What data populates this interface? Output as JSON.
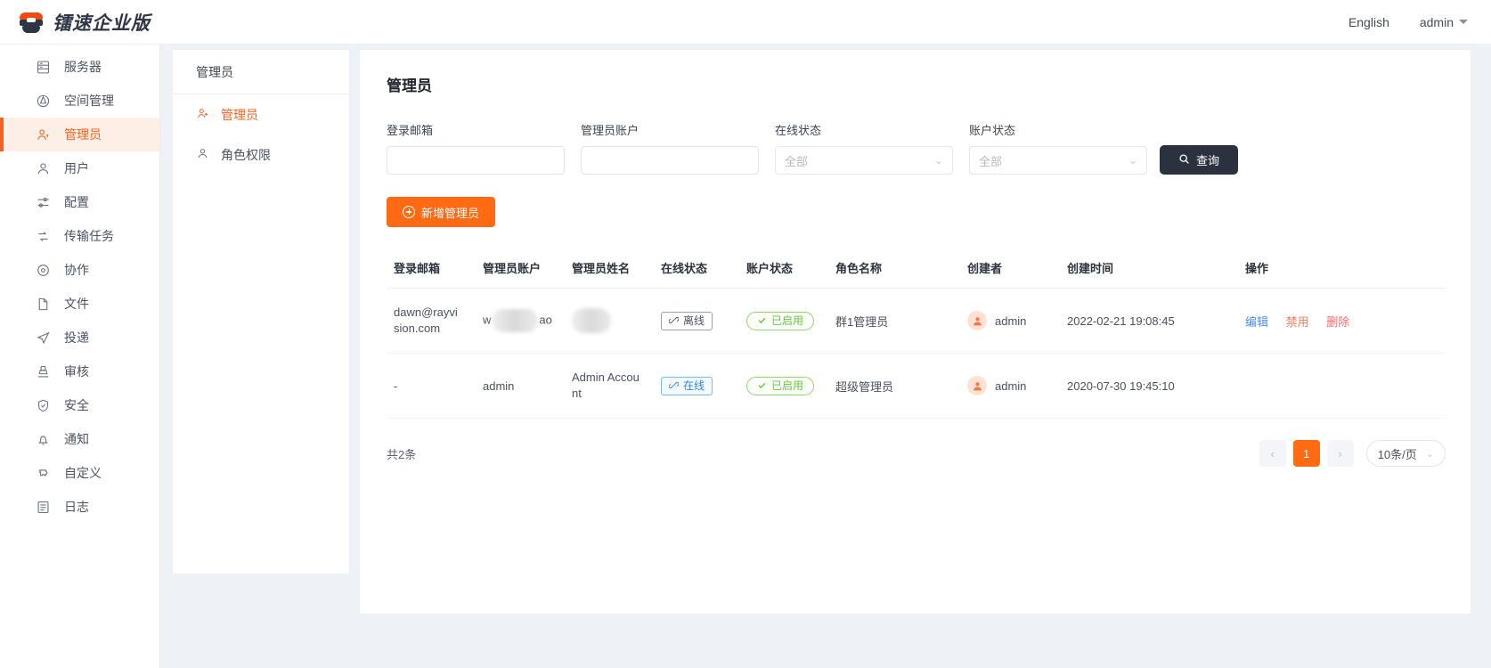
{
  "topbar": {
    "brand_name": "镭速企业版",
    "language": "English",
    "user": "admin"
  },
  "sidebar": {
    "items": [
      {
        "label": "服务器",
        "icon": "server-icon",
        "active": false
      },
      {
        "label": "空间管理",
        "icon": "space-icon",
        "active": false
      },
      {
        "label": "管理员",
        "icon": "admin-icon",
        "active": true
      },
      {
        "label": "用户",
        "icon": "user-icon",
        "active": false
      },
      {
        "label": "配置",
        "icon": "settings-sliders-icon",
        "active": false
      },
      {
        "label": "传输任务",
        "icon": "transfer-icon",
        "active": false
      },
      {
        "label": "协作",
        "icon": "collaboration-icon",
        "active": false
      },
      {
        "label": "文件",
        "icon": "file-icon",
        "active": false
      },
      {
        "label": "投递",
        "icon": "send-icon",
        "active": false
      },
      {
        "label": "审核",
        "icon": "audit-icon",
        "active": false
      },
      {
        "label": "安全",
        "icon": "shield-icon",
        "active": false
      },
      {
        "label": "通知",
        "icon": "bell-icon",
        "active": false
      },
      {
        "label": "自定义",
        "icon": "puzzle-icon",
        "active": false
      },
      {
        "label": "日志",
        "icon": "log-icon",
        "active": false
      }
    ]
  },
  "subpanel": {
    "title": "管理员",
    "items": [
      {
        "label": "管理员",
        "icon": "admin-user-icon",
        "active": true
      },
      {
        "label": "角色权限",
        "icon": "role-user-icon",
        "active": false
      }
    ]
  },
  "main": {
    "page_title": "管理员",
    "filters": {
      "email": {
        "label": "登录邮箱",
        "value": "",
        "placeholder": ""
      },
      "account": {
        "label": "管理员账户",
        "value": "",
        "placeholder": ""
      },
      "online_status": {
        "label": "在线状态",
        "value": "全部"
      },
      "account_status": {
        "label": "账户状态",
        "value": "全部"
      },
      "query_button": "查询"
    },
    "add_button": "新增管理员",
    "table": {
      "headers": [
        "登录邮箱",
        "管理员账户",
        "管理员姓名",
        "在线状态",
        "账户状态",
        "角色名称",
        "创建者",
        "创建时间",
        "操作"
      ],
      "rows": [
        {
          "email": "dawn@rayvision.com",
          "account": "w",
          "account_suffix": "ao",
          "account_redacted": true,
          "name": "",
          "name_redacted": true,
          "online_status": "离线",
          "online_state": "offline",
          "account_status": "已启用",
          "role": "群1管理员",
          "creator": "admin",
          "created_at": "2022-02-21 19:08:45",
          "ops": [
            "编辑",
            "禁用",
            "删除"
          ]
        },
        {
          "email": "-",
          "account": "admin",
          "account_suffix": "",
          "account_redacted": false,
          "name": "Admin Account",
          "name_redacted": false,
          "online_status": "在线",
          "online_state": "online",
          "account_status": "已启用",
          "role": "超级管理员",
          "creator": "admin",
          "created_at": "2020-07-30 19:45:10",
          "ops": []
        }
      ]
    },
    "footer": {
      "total": "共2条",
      "prev": "‹",
      "page": "1",
      "next": "›",
      "page_size": "10条/页"
    }
  },
  "colors": {
    "accent": "#ff6a13",
    "dark": "#2b313f",
    "link": "#4e8df5",
    "danger": "#f56c6c",
    "success": "#6bbf4a",
    "online": "#2f86e0"
  }
}
